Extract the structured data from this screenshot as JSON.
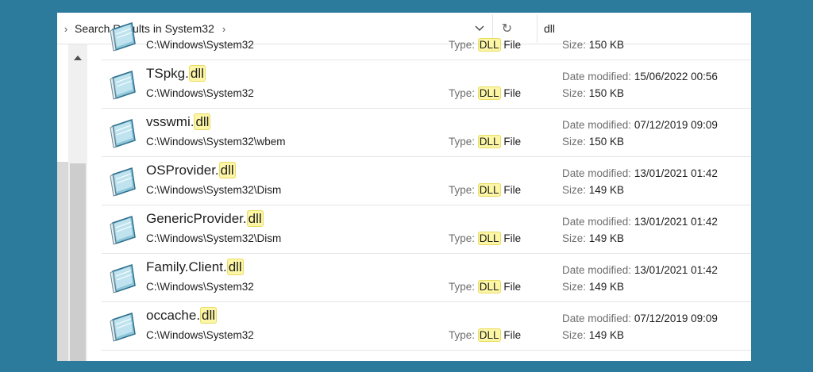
{
  "toolbar": {
    "breadcrumb": "Search Results in System32",
    "search_value": "dll"
  },
  "labels": {
    "type": "Type:",
    "date_modified": "Date modified:",
    "size": "Size:",
    "type_suffix": "File"
  },
  "highlight": "dll",
  "type_highlight": "DLL",
  "rows": [
    {
      "name_base": "",
      "name_ext": "",
      "path": "C:\\Windows\\System32",
      "date": "",
      "size": "150 KB"
    },
    {
      "name_base": "TSpkg.",
      "name_ext": "dll",
      "path": "C:\\Windows\\System32",
      "date": "15/06/2022 00:56",
      "size": "150 KB"
    },
    {
      "name_base": "vsswmi.",
      "name_ext": "dll",
      "path": "C:\\Windows\\System32\\wbem",
      "date": "07/12/2019 09:09",
      "size": "150 KB"
    },
    {
      "name_base": "OSProvider.",
      "name_ext": "dll",
      "path": "C:\\Windows\\System32\\Dism",
      "date": "13/01/2021 01:42",
      "size": "149 KB"
    },
    {
      "name_base": "GenericProvider.",
      "name_ext": "dll",
      "path": "C:\\Windows\\System32\\Dism",
      "date": "13/01/2021 01:42",
      "size": "149 KB"
    },
    {
      "name_base": "Family.Client.",
      "name_ext": "dll",
      "path": "C:\\Windows\\System32",
      "date": "13/01/2021 01:42",
      "size": "149 KB"
    },
    {
      "name_base": "occache.",
      "name_ext": "dll",
      "path": "C:\\Windows\\System32",
      "date": "07/12/2019 09:09",
      "size": "149 KB"
    }
  ]
}
